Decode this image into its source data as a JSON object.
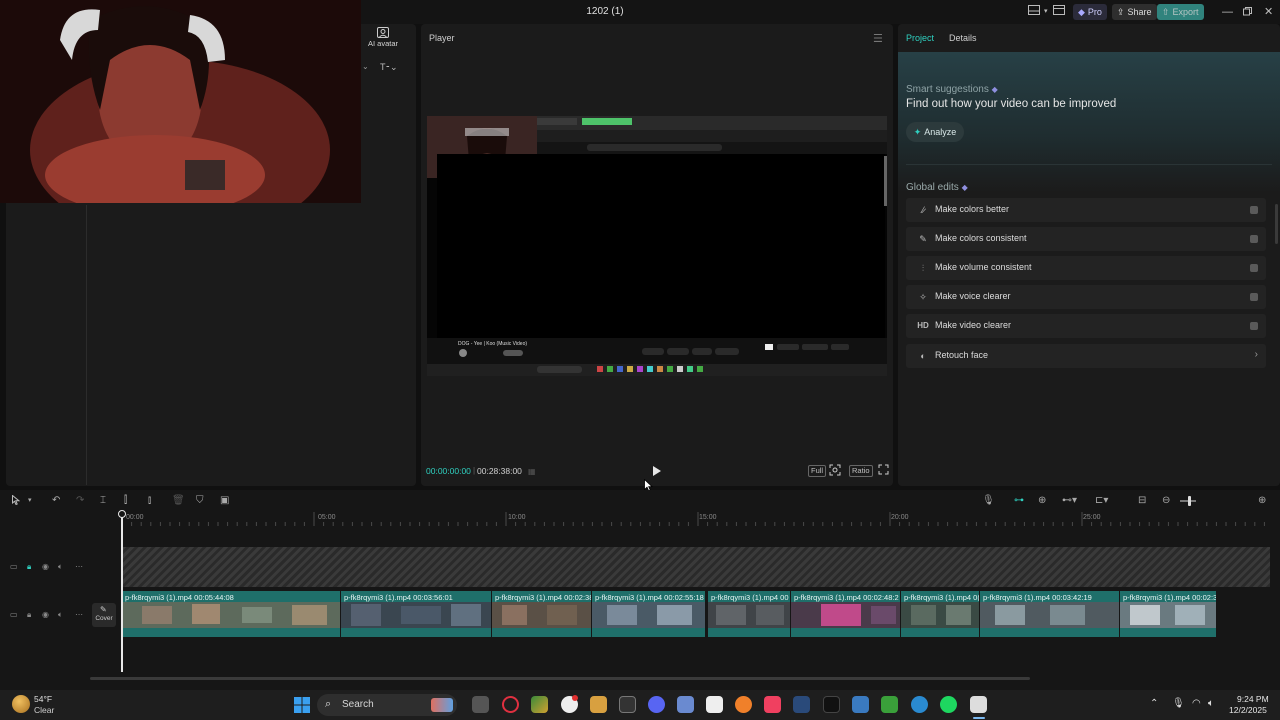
{
  "window": {
    "title": "1202 (1)",
    "pro_label": "Pro",
    "share_label": "Share",
    "export_label": "Export"
  },
  "left_panel": {
    "ai_avatar_label": "AI avatar"
  },
  "player": {
    "title": "Player",
    "time_current": "00:00:00:00",
    "time_total": "00:28:38:00",
    "full_label": "Full",
    "ratio_label": "Ratio",
    "inner_video_title": "DOG - Yee | Koo (Music Video)"
  },
  "right_panel": {
    "tab_project": "Project",
    "tab_details": "Details",
    "smart_suggestions_label": "Smart suggestions",
    "smart_title": "Find out how your video can be improved",
    "analyze_label": "Analyze",
    "global_edits_label": "Global edits",
    "edits": [
      {
        "label": "Make colors better",
        "icon": "magic-wand-icon",
        "kind": "toggle"
      },
      {
        "label": "Make colors consistent",
        "icon": "color-picker-icon",
        "kind": "toggle"
      },
      {
        "label": "Make volume consistent",
        "icon": "equalizer-icon",
        "kind": "toggle"
      },
      {
        "label": "Make voice clearer",
        "icon": "sparkle-icon",
        "kind": "toggle"
      },
      {
        "label": "Make video clearer",
        "icon": "hd-icon",
        "kind": "toggle",
        "icon_text": "HD"
      },
      {
        "label": "Retouch face",
        "icon": "retouch-icon",
        "kind": "chevron"
      }
    ]
  },
  "timeline": {
    "ruler_labels": [
      "00:00",
      "05:00",
      "10:00",
      "15:00",
      "20:00",
      "25:00"
    ],
    "cover_label": "Cover",
    "clips": [
      {
        "name": "p-fk8rqymi3 (1).mp4   00:05:44:08"
      },
      {
        "name": "p-fk8rqymi3 (1).mp4   00:03:56:01"
      },
      {
        "name": "p-fk8rqymi3 (1).mp4   00:02:38"
      },
      {
        "name": "p-fk8rqymi3 (1).mp4   00:02:55:18"
      },
      {
        "name": "p-fk8rqymi3 (1).mp4   00"
      },
      {
        "name": "p-fk8rqymi3 (1).mp4   00:02:48:2"
      },
      {
        "name": "p-fk8rqymi3 (1).mp4   0("
      },
      {
        "name": "p-fk8rqymi3 (1).mp4   00:03:42:19"
      },
      {
        "name": "p-fk8rqymi3 (1).mp4   00:02:3"
      }
    ]
  },
  "taskbar": {
    "weather_temp": "54°F",
    "weather_desc": "Clear",
    "search_label": "Search",
    "clock_time": "9:24 PM",
    "clock_date": "12/2/2025"
  },
  "colors": {
    "accent": "#2fd0c0",
    "clip": "#1f6f6a",
    "export_bg": "#3aa8a0"
  }
}
